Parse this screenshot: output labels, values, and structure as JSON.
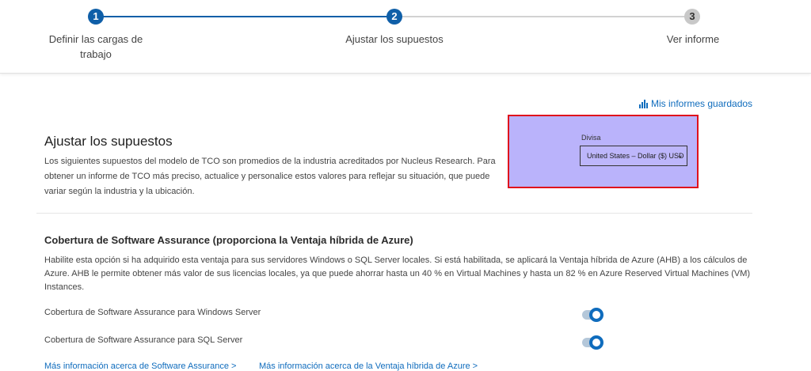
{
  "stepper": {
    "steps": [
      {
        "number": "1",
        "label": "Definir las cargas de trabajo",
        "state": "done"
      },
      {
        "number": "2",
        "label": "Ajustar los supuestos",
        "state": "active"
      },
      {
        "number": "3",
        "label": "Ver informe",
        "state": "upcoming"
      }
    ],
    "step1_label_line1": "Definir las cargas de",
    "step1_label_line2": "trabajo"
  },
  "saved_reports": {
    "icon": "bar-chart-icon",
    "label": "Mis informes guardados"
  },
  "section": {
    "title": "Ajustar los supuestos",
    "description": "Los siguientes supuestos del modelo de TCO son promedios de la industria acreditados por Nucleus Research. Para obtener un informe de TCO más preciso, actualice y personalice estos valores para reflejar su situación, que puede variar según la industria y la ubicación."
  },
  "currency": {
    "label": "Divisa",
    "selected": "United States – Dollar ($) USD",
    "icon": "chevron-down-icon"
  },
  "software_assurance": {
    "title": "Cobertura de Software Assurance (proporciona la Ventaja híbrida de Azure)",
    "description": "Habilite esta opción si ha adquirido esta ventaja para sus servidores Windows o SQL Server locales. Si está habilitada, se aplicará la Ventaja híbrida de Azure (AHB) a los cálculos de Azure. AHB le permite obtener más valor de sus licencias locales, ya que puede ahorrar hasta un 40 % en Virtual Machines y hasta un 82 % en Azure Reserved Virtual Machines (VM) Instances.",
    "toggles": [
      {
        "label": "Cobertura de Software Assurance para Windows Server",
        "on": true
      },
      {
        "label": "Cobertura de Software Assurance para SQL Server",
        "on": true
      }
    ],
    "links": [
      "Más información acerca de Software Assurance >",
      "Más información acerca de la Ventaja híbrida de Azure >"
    ]
  },
  "colors": {
    "accent": "#0f6cbd",
    "step_active": "#0f5fa8",
    "highlight_fill": "#bab3fb",
    "highlight_border": "#e0111c"
  }
}
